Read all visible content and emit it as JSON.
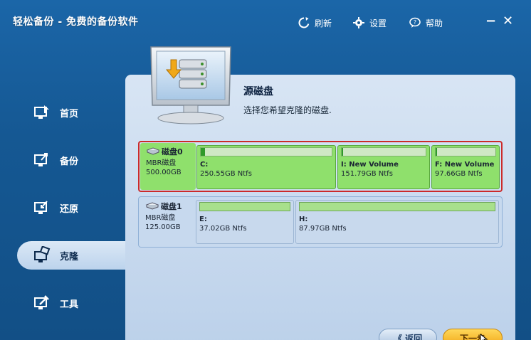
{
  "app": {
    "title": "轻松备份 - 免费的备份软件"
  },
  "toolbar": {
    "refresh_label": "刷新",
    "settings_label": "设置",
    "help_label": "帮助",
    "minimize_glyph": "−",
    "close_glyph": "✕"
  },
  "sidebar": {
    "items": [
      {
        "label": "首页",
        "icon": "home-icon"
      },
      {
        "label": "备份",
        "icon": "backup-icon"
      },
      {
        "label": "还原",
        "icon": "restore-icon"
      },
      {
        "label": "克隆",
        "icon": "clone-icon",
        "active": true
      },
      {
        "label": "工具",
        "icon": "tools-icon"
      }
    ]
  },
  "main": {
    "heading": "源磁盘",
    "subtitle": "选择您希望克隆的磁盘.",
    "disks": [
      {
        "name": "磁盘0",
        "type": "MBR磁盘",
        "size": "500.00GB",
        "selected": true,
        "partitions": [
          {
            "letter": "C:",
            "size": "250.55GB Ntfs",
            "used_fraction": 0.03
          },
          {
            "letter": "I: New Volume",
            "size": "151.79GB Ntfs",
            "used_fraction": 0.02
          },
          {
            "letter": "F: New Volume",
            "size": "97.66GB Ntfs",
            "used_fraction": 0.02
          }
        ]
      },
      {
        "name": "磁盘1",
        "type": "MBR磁盘",
        "size": "125.00GB",
        "selected": false,
        "partitions": [
          {
            "letter": "E:",
            "size": "37.02GB Ntfs",
            "used_fraction": 0.0
          },
          {
            "letter": "H:",
            "size": "87.97GB Ntfs",
            "used_fraction": 0.0
          }
        ]
      }
    ]
  },
  "footer": {
    "back_label": "《 返回",
    "next_label": "下一步"
  },
  "colors": {
    "selection_border": "#cc2a2a",
    "selected_partition": "#8fe06c",
    "accent_next": "#f1a514"
  }
}
